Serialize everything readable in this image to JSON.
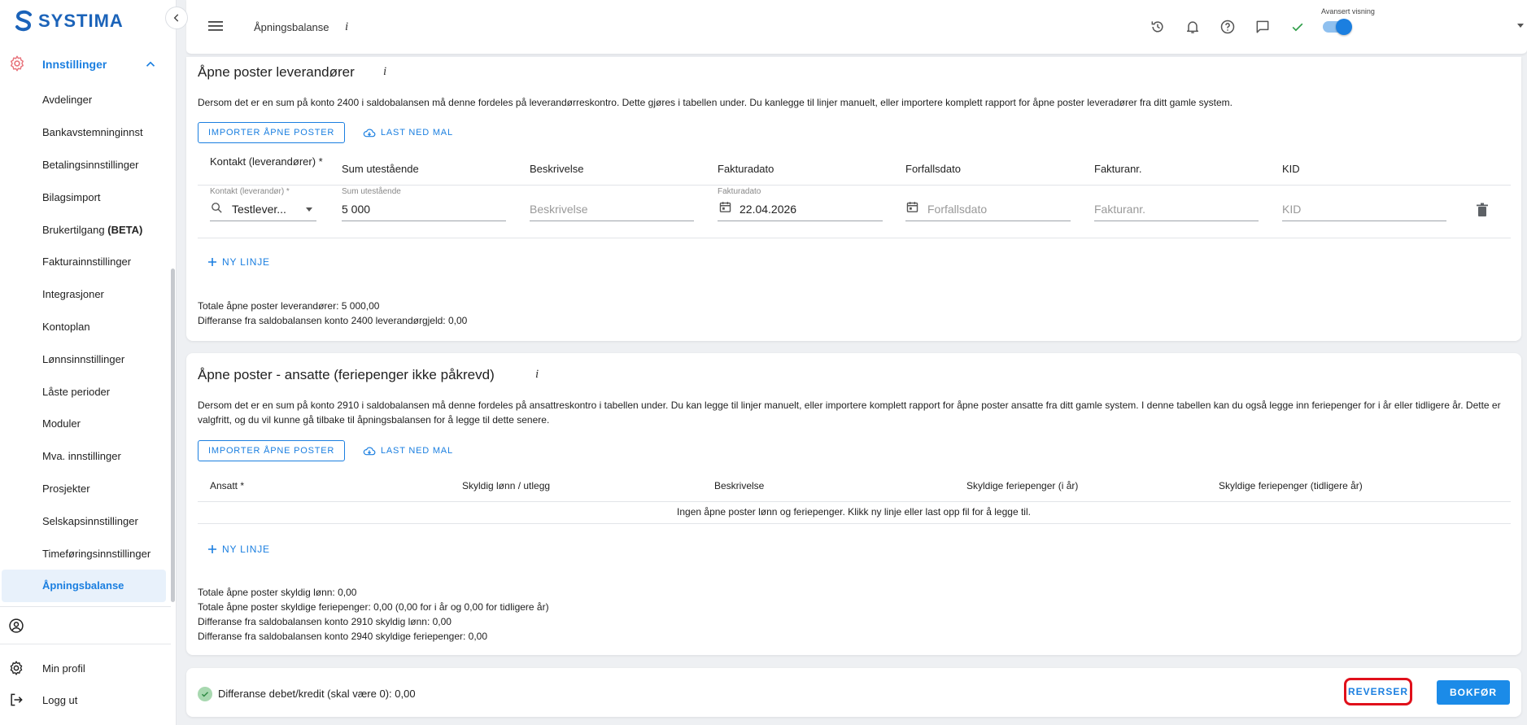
{
  "app": {
    "logo_text": "SYSTIMA",
    "brand_color": "#1b63b9",
    "accent_color": "#1b7fe0"
  },
  "sidebar": {
    "parent_label": "Innstillinger",
    "items": [
      {
        "label": "Avdelinger"
      },
      {
        "label": "Bankavstemninginnst"
      },
      {
        "label": "Betalingsinnstillinger"
      },
      {
        "label": "Bilagsimport"
      },
      {
        "label": "Brukertilgang",
        "badge": "(BETA)"
      },
      {
        "label": "Fakturainnstillinger"
      },
      {
        "label": "Integrasjoner"
      },
      {
        "label": "Kontoplan"
      },
      {
        "label": "Lønnsinnstillinger"
      },
      {
        "label": "Låste perioder"
      },
      {
        "label": "Moduler"
      },
      {
        "label": "Mva. innstillinger"
      },
      {
        "label": "Prosjekter"
      },
      {
        "label": "Selskapsinnstillinger"
      },
      {
        "label": "Timeføringsinnstillinger"
      },
      {
        "label": "Åpningsbalanse",
        "active": true
      }
    ],
    "min_profil": "Min profil",
    "logg_ut": "Logg ut"
  },
  "topbar": {
    "title": "Åpningsbalanse",
    "info": "i",
    "advanced_label": "Avansert visning",
    "advanced_on": true
  },
  "suppliers": {
    "title": "Åpne poster leverandører",
    "info": "i",
    "description": "Dersom det er en sum på konto 2400 i saldobalansen må denne fordeles på leverandørreskontro. Dette gjøres i tabellen under. Du kanlegge til linjer manuelt, eller importere komplett rapport for åpne poster leveradører fra ditt gamle system.",
    "import_button": "IMPORTER ÅPNE POSTER",
    "download_button": "LAST NED MAL",
    "columns": [
      "Kontakt (leverandører) *",
      "Sum utestående",
      "Beskrivelse",
      "Fakturadato",
      "Forfallsdato",
      "Fakturanr.",
      "KID"
    ],
    "row": {
      "contact_label": "Kontakt (leverandør) *",
      "contact_value": "Testlever...",
      "sum_label": "Sum utestående",
      "sum_value": "5 000",
      "desc_placeholder": "Beskrivelse",
      "invoice_date_label": "Fakturadato",
      "invoice_date_value": "22.04.2026",
      "due_date_placeholder": "Forfallsdato",
      "invoice_no_placeholder": "Fakturanr.",
      "kid_placeholder": "KID"
    },
    "new_line": "NY LINJE",
    "total": "Totale åpne poster leverandører: 5 000,00",
    "difference": "Differanse fra saldobalansen konto 2400 leverandørgjeld: 0,00"
  },
  "employees": {
    "title": "Åpne poster - ansatte (feriepenger ikke påkrevd)",
    "info": "i",
    "description": "Dersom det er en sum på konto 2910 i saldobalansen må denne fordeles på ansattreskontro i tabellen under. Du kan legge til linjer manuelt, eller importere komplett rapport for åpne poster ansatte fra ditt gamle system. I denne tabellen kan du også legge inn feriepenger for i år eller tidligere år. Dette er valgfritt, og du vil kunne gå tilbake til åpningsbalansen for å legge til dette senere.",
    "import_button": "IMPORTER ÅPNE POSTER",
    "download_button": "LAST NED MAL",
    "columns": [
      "Ansatt *",
      "Skyldig lønn / utlegg",
      "Beskrivelse",
      "Skyldige feriepenger (i år)",
      "Skyldige feriepenger (tidligere år)"
    ],
    "empty_message": "Ingen åpne poster lønn og feriepenger. Klikk ny linje eller last opp fil for å legge til.",
    "new_line": "NY LINJE",
    "summary": [
      "Totale åpne poster skyldig lønn: 0,00",
      "Totale åpne poster skyldige feriepenger: 0,00 (0,00 for i år og 0,00 for tidligere år)",
      "Differanse fra saldobalansen konto 2910 skyldig lønn: 0,00",
      "Differanse fra saldobalansen konto 2940 skyldige feriepenger: 0,00"
    ]
  },
  "footer": {
    "difference": "Differanse debet/kredit (skal være 0): 0,00",
    "reverse_button": "REVERSER",
    "post_button": "BOKFØR",
    "highlight_color": "#e0101b"
  }
}
